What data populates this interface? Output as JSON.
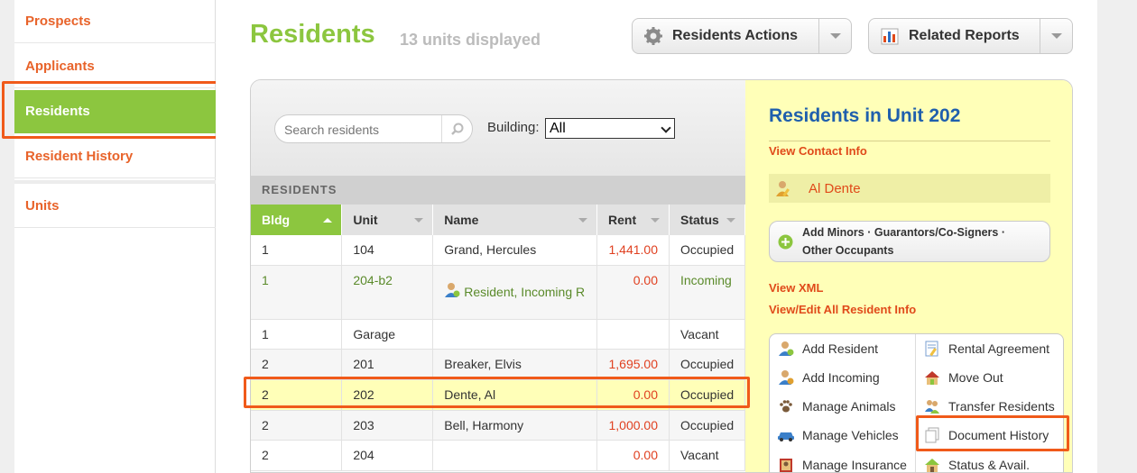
{
  "sidebar": {
    "items": [
      {
        "label": "Prospects"
      },
      {
        "label": "Applicants"
      },
      {
        "label": "Residents"
      },
      {
        "label": "Resident History"
      },
      {
        "label": "Units"
      }
    ]
  },
  "header": {
    "title": "Residents",
    "subtitle": "13 units displayed",
    "actions_button": "Residents Actions",
    "reports_button": "Related Reports"
  },
  "toolbar": {
    "search_placeholder": "Search residents",
    "building_label": "Building:",
    "building_value": "All"
  },
  "table": {
    "section_label": "RESIDENTS",
    "columns": [
      "Bldg",
      "Unit",
      "Name",
      "Rent",
      "Status"
    ],
    "rows": [
      {
        "bldg": "1",
        "unit": "104",
        "name": "Grand, Hercules",
        "rent": "1,441.00",
        "status": "Occupied"
      },
      {
        "bldg": "1",
        "unit": "204-b2",
        "name": "Resident, Incoming R",
        "rent": "0.00",
        "status": "Incoming"
      },
      {
        "bldg": "1",
        "unit": "Garage",
        "name": "",
        "rent": "",
        "status": "Vacant"
      },
      {
        "bldg": "2",
        "unit": "201",
        "name": "Breaker, Elvis",
        "rent": "1,695.00",
        "status": "Occupied"
      },
      {
        "bldg": "2",
        "unit": "202",
        "name": "Dente, Al",
        "rent": "0.00",
        "status": "Occupied"
      },
      {
        "bldg": "2",
        "unit": "203",
        "name": "Bell, Harmony",
        "rent": "1,000.00",
        "status": "Occupied"
      },
      {
        "bldg": "2",
        "unit": "204",
        "name": "",
        "rent": "0.00",
        "status": "Vacant"
      }
    ]
  },
  "unit_panel": {
    "title": "Residents in Unit 202",
    "view_contact": "View Contact Info",
    "resident_name": "Al Dente",
    "add_others": "Add Minors · Guarantors/Co-Signers · Other Occupants",
    "view_xml": "View XML",
    "view_edit_all": "View/Edit All Resident Info",
    "actions": [
      {
        "label": "Add Resident",
        "icon": "add-resident-icon"
      },
      {
        "label": "Rental Agreement",
        "icon": "rental-agreement-icon"
      },
      {
        "label": "Add Incoming",
        "icon": "add-incoming-icon"
      },
      {
        "label": "Move Out",
        "icon": "move-out-icon"
      },
      {
        "label": "Manage Animals",
        "icon": "paw-icon"
      },
      {
        "label": "Transfer Residents",
        "icon": "transfer-icon"
      },
      {
        "label": "Manage Vehicles",
        "icon": "car-icon"
      },
      {
        "label": "Document History",
        "icon": "document-icon"
      },
      {
        "label": "Manage Insurance",
        "icon": "insurance-icon"
      },
      {
        "label": "Status & Avail.",
        "icon": "house-icon"
      }
    ]
  },
  "colors": {
    "accent_green": "#8cc63f",
    "accent_orange": "#e8632a",
    "title_blue": "#1f5fad",
    "highlight_yellow": "#ffffb8",
    "annotation_orange": "#f05a1a"
  }
}
